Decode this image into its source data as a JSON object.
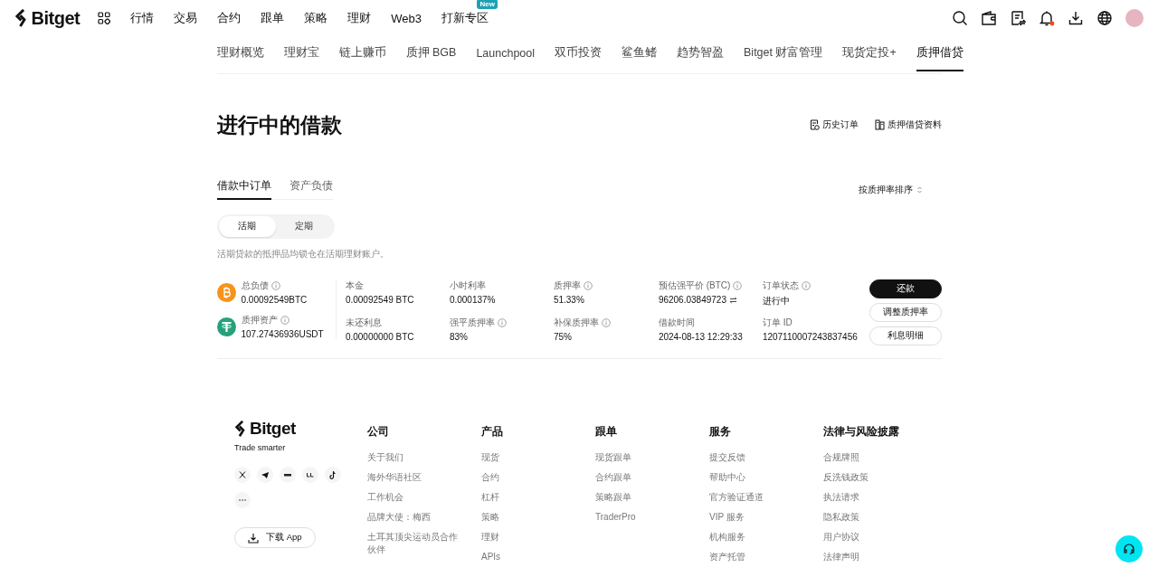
{
  "header": {
    "logo": "Bitget",
    "nav": [
      {
        "label": "行情"
      },
      {
        "label": "交易"
      },
      {
        "label": "合约"
      },
      {
        "label": "跟单"
      },
      {
        "label": "策略"
      },
      {
        "label": "理财"
      },
      {
        "label": "Web3"
      },
      {
        "label": "打新专区",
        "badge": "New"
      }
    ],
    "notification_dot": true
  },
  "subnav": [
    {
      "label": "理财概览",
      "selected": false
    },
    {
      "label": "理财宝",
      "selected": false
    },
    {
      "label": "链上赚币",
      "selected": false
    },
    {
      "label": "质押 BGB",
      "selected": false
    },
    {
      "label": "Launchpool",
      "selected": false
    },
    {
      "label": "双币投资",
      "selected": false
    },
    {
      "label": "鲨鱼鳍",
      "selected": false
    },
    {
      "label": "趋势智盈",
      "selected": false
    },
    {
      "label": "Bitget 财富管理",
      "selected": false
    },
    {
      "label": "现货定投+",
      "selected": false
    },
    {
      "label": "质押借贷",
      "selected": true
    }
  ],
  "page": {
    "title": "进行中的借款",
    "links": [
      {
        "kind": "history",
        "label": "历史订单"
      },
      {
        "kind": "docs",
        "label": "质押借贷资料"
      }
    ]
  },
  "tabs": [
    {
      "label": "借款中订单",
      "selected": true
    },
    {
      "label": "资产负债",
      "selected": false
    }
  ],
  "sort": {
    "label": "按质押率排序"
  },
  "segments": [
    {
      "label": "活期",
      "selected": true
    },
    {
      "label": "定期",
      "selected": false
    }
  ],
  "note": "活期贷款的抵押品均锁仓在活期理财账户。",
  "loan": {
    "assets": [
      {
        "kind": "btc",
        "label": "总负债",
        "value": "0.00092549BTC"
      },
      {
        "kind": "usdt",
        "label": "质押资产",
        "value": "107.27436936USDT"
      }
    ],
    "fields": [
      {
        "label": "本金",
        "value": "0.00092549 BTC",
        "info": false,
        "swap": false
      },
      {
        "label": "未还利息",
        "value": "0.00000000 BTC",
        "info": false,
        "swap": false
      },
      {
        "label": "小时利率",
        "value": "0.000137%",
        "info": false,
        "swap": false
      },
      {
        "label": "强平质押率",
        "value": "83%",
        "info": true,
        "swap": false
      },
      {
        "label": "质押率",
        "value": "51.33%",
        "info": true,
        "swap": false
      },
      {
        "label": "补保质押率",
        "value": "75%",
        "info": true,
        "swap": false
      },
      {
        "label": "预估强平价 (BTC)",
        "value": "96206.03849723",
        "info": true,
        "swap": true
      },
      {
        "label": "借款时间",
        "value": "2024-08-13 12:29:33",
        "info": false,
        "swap": false
      },
      {
        "label": "订单状态",
        "value": "进行中",
        "info": true,
        "swap": false
      },
      {
        "label": "订单 ID",
        "value": "1207110007243837456",
        "info": false,
        "swap": false
      }
    ],
    "buttons": [
      {
        "label": "还款",
        "primary": true
      },
      {
        "label": "调整质押率",
        "primary": false
      },
      {
        "label": "利息明细",
        "primary": false
      }
    ]
  },
  "footer": {
    "logo": "Bitget",
    "tagline": "Trade smarter",
    "download": "下载 App",
    "columns": [
      {
        "title": "公司",
        "links": [
          "关于我们",
          "海外华语社区",
          "工作机会",
          "品牌大使：梅西",
          "土耳其顶尖运动员合作伙伴"
        ]
      },
      {
        "title": "产品",
        "links": [
          "现货",
          "合约",
          "杠杆",
          "策略",
          "理财",
          "APIs"
        ]
      },
      {
        "title": "跟单",
        "links": [
          "现货跟单",
          "合约跟单",
          "策略跟单",
          "TraderPro"
        ]
      },
      {
        "title": "服务",
        "links": [
          "提交反馈",
          "帮助中心",
          "官方验证通道",
          "VIP 服务",
          "机构服务",
          "资产托管"
        ]
      },
      {
        "title": "法律与风险披露",
        "links": [
          "合规牌照",
          "反洗钱政策",
          "执法请求",
          "隐私政策",
          "用户协议",
          "法律声明"
        ]
      }
    ]
  }
}
